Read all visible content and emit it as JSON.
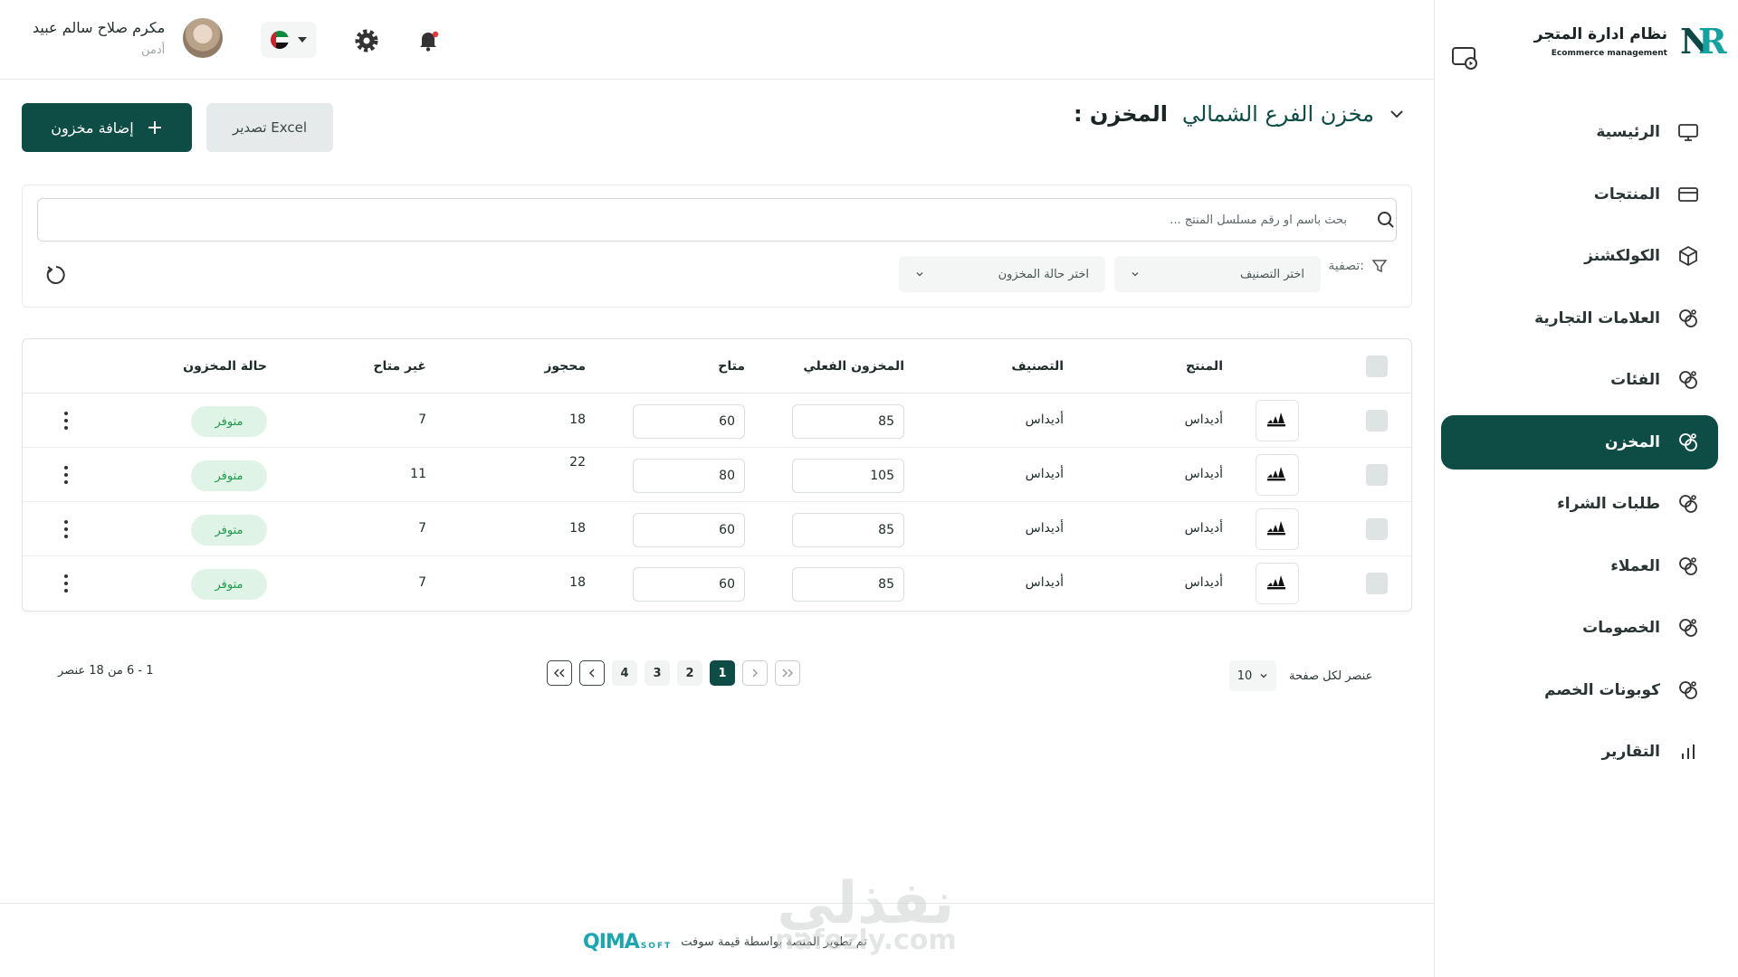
{
  "brand": {
    "title": "نظام ادارة المتجر",
    "subtitle": "Ecommerce management",
    "logo_text": "NR"
  },
  "sidebar": {
    "items": [
      {
        "label": "الرئيسية",
        "icon": "monitor-icon"
      },
      {
        "label": "المنتجات",
        "icon": "card-icon"
      },
      {
        "label": "الكولكشنز",
        "icon": "box-icon"
      },
      {
        "label": "العلامات التجارية",
        "icon": "blob-icon"
      },
      {
        "label": "الفئات",
        "icon": "blob-icon"
      },
      {
        "label": "المخزن",
        "icon": "blob-icon",
        "active": true
      },
      {
        "label": "طلبات الشراء",
        "icon": "blob-icon"
      },
      {
        "label": "العملاء",
        "icon": "blob-icon"
      },
      {
        "label": "الخصومات",
        "icon": "blob-icon"
      },
      {
        "label": "كوبونات الخصم",
        "icon": "blob-icon"
      },
      {
        "label": "التقارير",
        "icon": "bar-chart-icon"
      }
    ]
  },
  "header": {
    "user_name": "مكرم صلاح سالم عبيد",
    "user_role": "أدمن"
  },
  "page": {
    "title_label": "المخزن :",
    "title_value": "مخزن الفرع الشمالي",
    "add_button": "إضافة مخزون",
    "export_button": "تصدير Excel"
  },
  "filters": {
    "search_placeholder": "بحث باسم او رقم مسلسل المنتج ...",
    "filter_label": "تصفية:",
    "category_placeholder": "اختر التصنيف",
    "stock_placeholder": "اختر حالة المخزون"
  },
  "table": {
    "headers": {
      "product": "المنتج",
      "category": "التصنيف",
      "actual": "المخزون الفعلي",
      "available": "متاح",
      "reserved": "محجوز",
      "unavailable": "غير متاح",
      "status": "حالة المخزون"
    },
    "rows": [
      {
        "product": "أديداس",
        "category": "أديداس",
        "actual": "85",
        "available": "60",
        "reserved": "18",
        "unavailable": "7",
        "status": "متوفر"
      },
      {
        "product": "أديداس",
        "category": "أديداس",
        "actual": "105",
        "available": "80",
        "reserved": "22",
        "unavailable": "11",
        "status": "متوفر"
      },
      {
        "product": "أديداس",
        "category": "أديداس",
        "actual": "85",
        "available": "60",
        "reserved": "18",
        "unavailable": "7",
        "status": "متوفر"
      },
      {
        "product": "أديداس",
        "category": "أديداس",
        "actual": "85",
        "available": "60",
        "reserved": "18",
        "unavailable": "7",
        "status": "متوفر"
      }
    ]
  },
  "pagination": {
    "pages": [
      "1",
      "2",
      "3",
      "4"
    ],
    "current": "1",
    "range_text": "1 - 6 من 18 عنصر",
    "per_page_label": "عنصر لكل صفحة",
    "per_page_value": "10"
  },
  "footer": {
    "text": "تم تطوير المنصة بواسطة قيمة سوفت",
    "logo_main": "QIMA",
    "logo_sub": "SOFT"
  },
  "watermark": {
    "line1": "نفذلي",
    "line2": "nafezly.com"
  },
  "colors": {
    "primary": "#0e4c46",
    "accent": "#12a3a0",
    "badge_bg": "#dff4e6",
    "badge_text": "#1f9a4d"
  }
}
